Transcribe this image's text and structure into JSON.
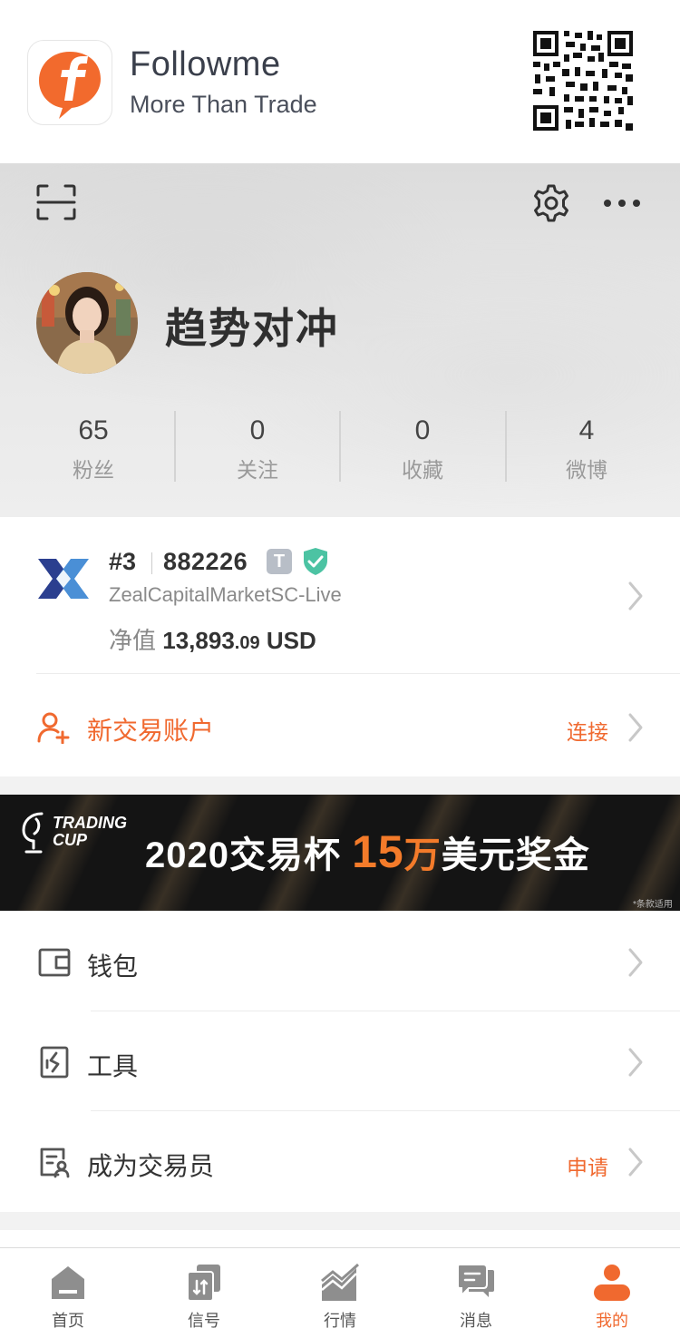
{
  "header": {
    "app_name": "Followme",
    "tagline": "More Than Trade"
  },
  "profile": {
    "username": "趋势对冲",
    "stats": [
      {
        "value": "65",
        "label": "粉丝"
      },
      {
        "value": "0",
        "label": "关注"
      },
      {
        "value": "0",
        "label": "收藏"
      },
      {
        "value": "4",
        "label": "微博"
      }
    ]
  },
  "account": {
    "rank": "#3",
    "number": "882226",
    "badge": "T",
    "server": "ZealCapitalMarketSC-Live",
    "equity_label": "净值",
    "equity_int": "13,893",
    "equity_dec": ".09",
    "currency": "USD"
  },
  "new_account": {
    "label": "新交易账户",
    "action": "连接"
  },
  "ad": {
    "brand_line1": "TRADING",
    "brand_line2": "CUP",
    "title_a": "2020交易杯 ",
    "title_amount": "15",
    "title_unit": "万",
    "title_b": "美元奖金",
    "note": "*条款适用"
  },
  "menu": [
    {
      "label": "钱包",
      "icon": "wallet-icon",
      "action": ""
    },
    {
      "label": "工具",
      "icon": "tools-icon",
      "action": ""
    },
    {
      "label": "成为交易员",
      "icon": "trader-apply-icon",
      "action": "申请"
    }
  ],
  "tabs": [
    {
      "label": "首页",
      "icon": "home-icon"
    },
    {
      "label": "信号",
      "icon": "signal-icon"
    },
    {
      "label": "行情",
      "icon": "market-icon"
    },
    {
      "label": "消息",
      "icon": "message-icon"
    },
    {
      "label": "我的",
      "icon": "profile-icon"
    }
  ],
  "colors": {
    "accent": "#f0692f",
    "ad_highlight": "#f47b2a",
    "verify_green": "#4cc3a3",
    "text_dark": "#333333"
  }
}
